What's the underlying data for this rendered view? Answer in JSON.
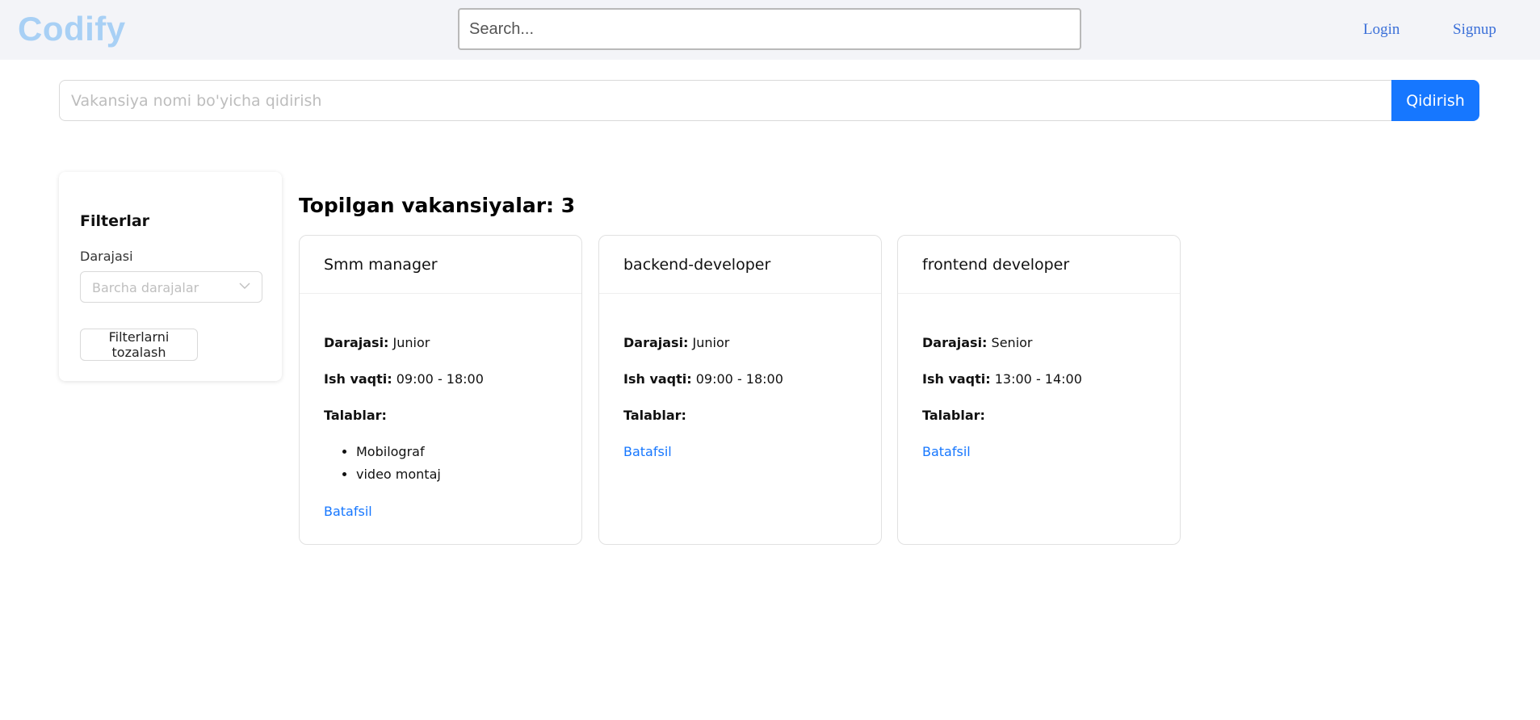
{
  "navbar": {
    "logo": "Codify",
    "search_placeholder": "Search...",
    "login": "Login",
    "signup": "Signup"
  },
  "vacancy_search": {
    "placeholder": "Vakansiya nomi bo'yicha qidirish",
    "button": "Qidirish"
  },
  "filters": {
    "title": "Filterlar",
    "level_label": "Darajasi",
    "level_placeholder": "Barcha darajalar",
    "clear_button": "Filterlarni tozalash"
  },
  "results": {
    "title": "Topilgan vakansiyalar: 3",
    "level_label": "Darajasi:",
    "time_label": "Ish vaqti:",
    "requirements_label": "Talablar:",
    "more_link": "Batafsil",
    "cards": [
      {
        "title": "Smm manager",
        "level": "Junior",
        "time": "09:00 - 18:00",
        "requirements": [
          "Mobilograf",
          "video montaj"
        ]
      },
      {
        "title": "backend-developer",
        "level": "Junior",
        "time": "09:00 - 18:00",
        "requirements": []
      },
      {
        "title": "frontend developer",
        "level": "Senior",
        "time": "13:00 - 14:00",
        "requirements": []
      }
    ]
  },
  "colors": {
    "navbar_bg": "#f3f4f8",
    "logo": "#a8d0f5",
    "nav_link": "#3a6fd8",
    "primary": "#1677ff"
  },
  "icons": {
    "select_chevron": "chevron-down-icon"
  }
}
